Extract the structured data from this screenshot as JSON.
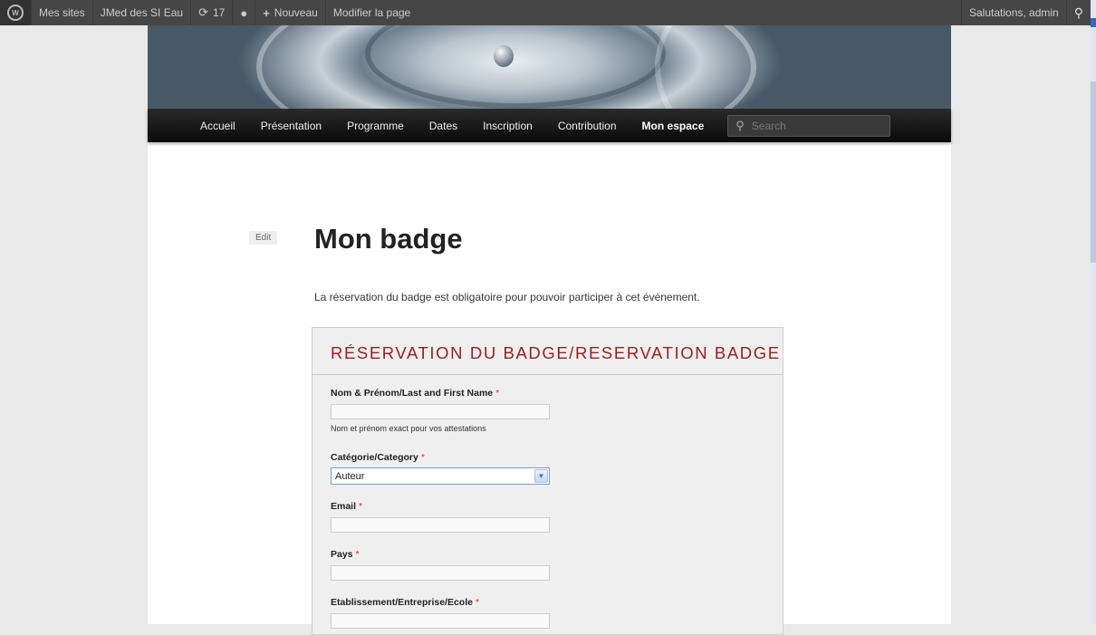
{
  "adminbar": {
    "items": [
      {
        "label": "Mes sites"
      },
      {
        "label": "JMed des SI Eau"
      },
      {
        "label": "17"
      },
      {
        "label": ""
      },
      {
        "label": "Nouveau"
      },
      {
        "label": "Modifier la page"
      }
    ],
    "greeting": "Salutations, admin"
  },
  "nav": {
    "items": [
      {
        "label": "Accueil"
      },
      {
        "label": "Présentation"
      },
      {
        "label": "Programme"
      },
      {
        "label": "Dates"
      },
      {
        "label": "Inscription"
      },
      {
        "label": "Contribution"
      },
      {
        "label": "Mon espace"
      }
    ],
    "active": "Mon espace",
    "search_placeholder": "Search"
  },
  "page": {
    "edit_label": "Edit",
    "title": "Mon badge",
    "intro": "La réservation du badge est obligatoire pour pouvoir participer à cet événement."
  },
  "form": {
    "title": "RÉSERVATION DU BADGE/RESERVATION BADGE",
    "required_mark": "*",
    "fields": [
      {
        "label": "Nom & Prénom/Last and First Name",
        "value": "",
        "help": "Nom et prénom exact pour vos attestations"
      },
      {
        "label": "Catégorie/Category",
        "value": "Auteur"
      },
      {
        "label": "Email",
        "value": ""
      },
      {
        "label": "Pays",
        "value": ""
      },
      {
        "label": "Etablissement/Entreprise/Ecole",
        "value": ""
      }
    ]
  },
  "colors": {
    "adminbar": "#464646",
    "form_title": "#9d1d1d",
    "required": "#cc3333"
  }
}
